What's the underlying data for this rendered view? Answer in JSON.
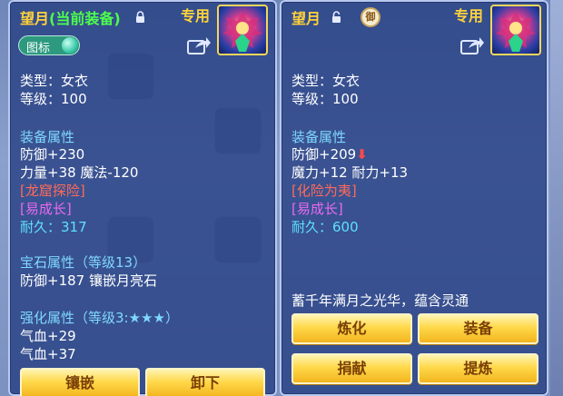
{
  "left_panel": {
    "title_name": "望月",
    "title_current": "(当前装备)",
    "exclusive": "专用",
    "badge_toggle_label": "图标",
    "type_line": "类型：女衣",
    "level_line": "等级：100",
    "attr_header": "装备属性",
    "attr_1": "防御+230",
    "attr_2": "力量+38 魔法-120",
    "special_1": "[龙窟探险]",
    "special_2": "[易成长]",
    "durability_label": "耐久：",
    "durability_value": "317",
    "gem_header": "宝石属性（等级13）",
    "gem_line": "防御+187 镶嵌月亮石",
    "enhance_header": "强化属性（等级3:★★★）",
    "enhance_1": "气血+29",
    "enhance_2": "气血+37",
    "buttons": [
      "镶嵌",
      "卸下"
    ]
  },
  "right_panel": {
    "title_name": "望月",
    "exclusive": "专用",
    "rival_mark": "御",
    "type_line": "类型：女衣",
    "level_line": "等级：100",
    "attr_header": "装备属性",
    "attr_1": "防御+209",
    "attr_2": "魔力+12 耐力+13",
    "special_1": "[化险为夷]",
    "special_2": "[易成长]",
    "durability_label": "耐久：",
    "durability_value": "600",
    "description": "蓄千年满月之光华，蕴含灵通",
    "buttons": [
      "炼化",
      "装备",
      "捐献",
      "提炼"
    ]
  },
  "colors": {
    "title_gold": "#ffd23a",
    "current_green": "#4dff4d",
    "section_blue": "#7fd8ff",
    "special_red": "#ff6a5a",
    "special_purple": "#e86af0",
    "durability_cyan": "#5ee0ff",
    "button_gold": "#ffd84a"
  }
}
